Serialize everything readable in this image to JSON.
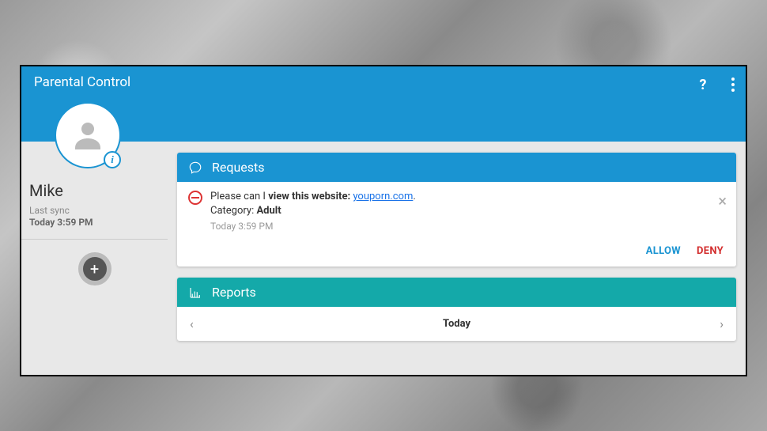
{
  "header": {
    "title": "Parental Control"
  },
  "sidebar": {
    "profile_name": "Mike",
    "sync_label": "Last sync",
    "sync_time": "Today 3:59 PM"
  },
  "requests": {
    "header": "Requests",
    "item": {
      "prefix": "Please can I ",
      "bold1": "view this website: ",
      "url": "youporn.com",
      "suffix": ".",
      "category_label": "Category: ",
      "category": "Adult",
      "time": "Today 3:59 PM"
    },
    "allow": "ALLOW",
    "deny": "DENY"
  },
  "reports": {
    "header": "Reports",
    "current": "Today"
  }
}
